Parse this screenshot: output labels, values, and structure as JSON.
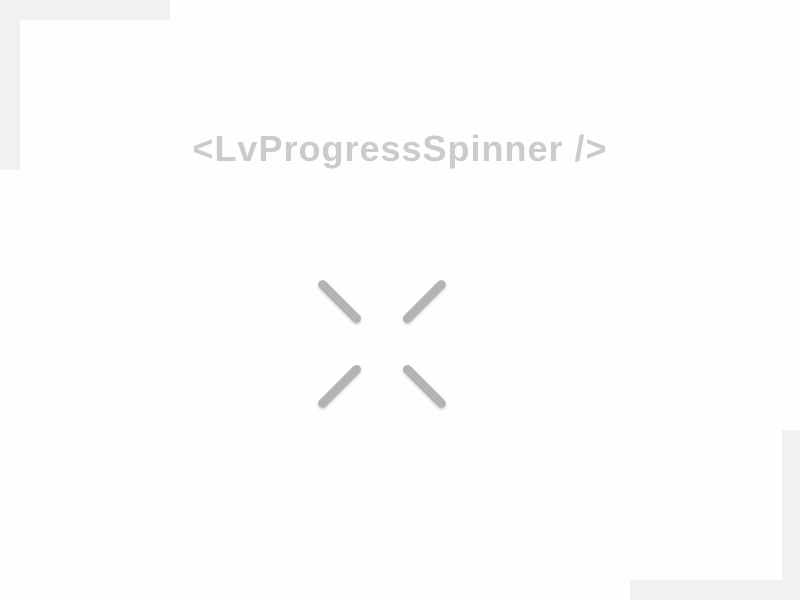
{
  "component": {
    "title": "<LvProgressSpinner />"
  },
  "spinner": {
    "icon": "loading-spinner-icon",
    "spoke_count": 8,
    "color": "#b3b3b3"
  },
  "colors": {
    "background": "#fefefe",
    "frame": "#f1f1f1",
    "title": "#cbcbcb"
  }
}
